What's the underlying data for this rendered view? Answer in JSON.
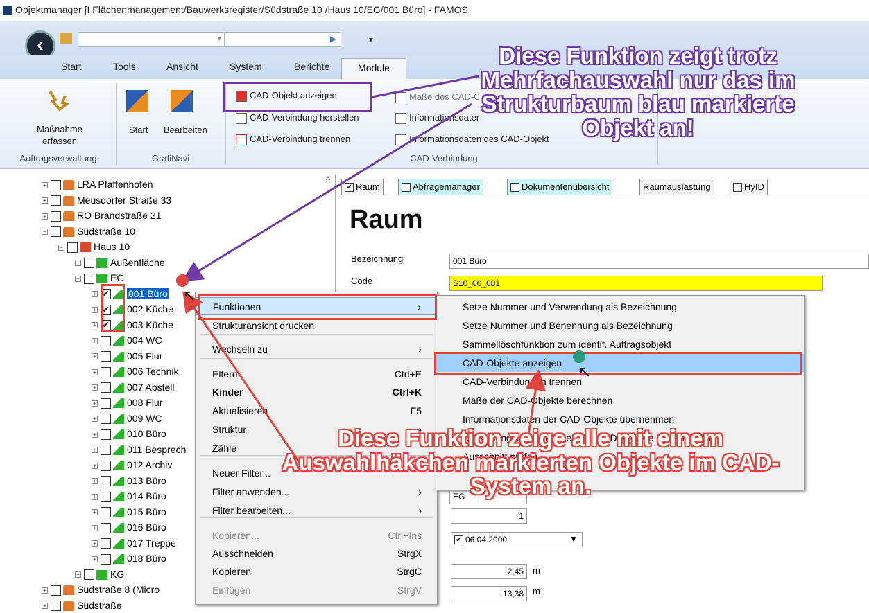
{
  "window": {
    "title": "Objektmanager [I  Flächenmanagement/Bauwerksregister/Südstraße 10  /Haus 10/EG/001 Büro] - FAMOS"
  },
  "qat": {
    "combo2_value": "▶"
  },
  "ribbon_tabs": [
    "Start",
    "Tools",
    "Ansicht",
    "System",
    "Berichte",
    "Module"
  ],
  "ribbon": {
    "auftrag": {
      "btn": "Maßnahme erfassen",
      "group": "Auftragsverwaltung"
    },
    "grafinavi": {
      "start": "Start",
      "bearbeiten": "Bearbeiten",
      "group": "GrafiNavi"
    },
    "cad": {
      "anzeigen": "CAD-Objekt anzeigen",
      "herstellen": "CAD-Verbindung herstellen",
      "trennen": "CAD-Verbindung trennen",
      "masse": "Maße des CAD-Objektes berechnen",
      "info": "Informationsdaten",
      "info2": "Informationsdaten des CAD-Objekt",
      "group": "CAD-Verbindung"
    }
  },
  "tree": [
    {
      "label": "LRA Pfaffenhofen",
      "pm": "+"
    },
    {
      "label": "Meusdorfer Straße 33",
      "pm": "+"
    },
    {
      "label": "RO Brandstraße 21",
      "pm": "+"
    },
    {
      "label": "Südstraße 10",
      "pm": "−"
    },
    {
      "label": "Haus 10",
      "pm": "−"
    },
    {
      "label": "Außenfläche",
      "pm": "+"
    },
    {
      "label": "EG",
      "pm": "−"
    },
    {
      "label": "001 Büro",
      "pm": "+",
      "checked": true,
      "selected": true
    },
    {
      "label": "002 Küche",
      "pm": "+",
      "checked": true
    },
    {
      "label": "003 Küche",
      "pm": "+",
      "checked": true
    },
    {
      "label": "004 WC",
      "pm": "+"
    },
    {
      "label": "005 Flur",
      "pm": "+"
    },
    {
      "label": "006 Technik",
      "pm": "+"
    },
    {
      "label": "007 Abstell",
      "pm": "+"
    },
    {
      "label": "008 Flur",
      "pm": "+"
    },
    {
      "label": "009 WC",
      "pm": "+"
    },
    {
      "label": "010 Büro",
      "pm": "+"
    },
    {
      "label": "011 Besprech",
      "pm": "+"
    },
    {
      "label": "012 Archiv",
      "pm": "+"
    },
    {
      "label": "013 Büro",
      "pm": "+"
    },
    {
      "label": "014 Büro",
      "pm": "+"
    },
    {
      "label": "015 Büro",
      "pm": "+"
    },
    {
      "label": "016 Büro",
      "pm": "+"
    },
    {
      "label": "017 Treppe",
      "pm": "+"
    },
    {
      "label": "018 Büro",
      "pm": "+"
    },
    {
      "label": "KG",
      "pm": "+"
    },
    {
      "label": "Südstraße 8 (Micro",
      "pm": "+"
    },
    {
      "label": "Südstraße",
      "pm": "+"
    }
  ],
  "right_tabs": [
    "Raum",
    "Abfragemanager",
    "Dokumentenübersicht",
    "Raumauslastung",
    "HyID"
  ],
  "form": {
    "title": "Raum",
    "bez_label": "Bezeichnung",
    "bez_value": "001 Büro",
    "code_label": "Code",
    "code_value": "S10_00_001",
    "eg_value": "EG",
    "num_value": "1",
    "date_value": "06.04.2000",
    "height": "2,45",
    "height_unit": "m",
    "area": "13,38",
    "area_unit": "m"
  },
  "context_menu": [
    {
      "label": "Funktionen",
      "arrow": "›"
    },
    {
      "label": "Strukturansicht drucken"
    },
    {
      "label": "Wechseln zu",
      "arrow": "›"
    },
    {
      "label": "Eltern",
      "shortcut": "Ctrl+E"
    },
    {
      "label": "Kinder",
      "shortcut": "Ctrl+K"
    },
    {
      "label": "Aktualisieren",
      "shortcut": "F5"
    },
    {
      "label": "Struktur",
      "arrow": "›"
    },
    {
      "label": "Zähle"
    },
    {
      "label": "Neuer Filter..."
    },
    {
      "label": "Filter anwenden...",
      "arrow": "›"
    },
    {
      "label": "Filter bearbeiten...",
      "arrow": "›"
    },
    {
      "label": "Kopieren...",
      "shortcut": "Ctrl+Ins"
    },
    {
      "label": "Ausschneiden",
      "shortcut": "StrgX"
    },
    {
      "label": "Kopieren",
      "shortcut": "StrgC"
    },
    {
      "label": "Einfügen",
      "shortcut": "StrgV"
    }
  ],
  "submenu": [
    "Setze Nummer und Verwendung als Bezeichnung",
    "Setze Nummer und Benennung als Bezeichnung",
    "Sammellöschfunktion zum identif. Auftragsobjekt",
    "CAD-Objekte anzeigen",
    "CAD-Verbindungen trennen",
    "Maße der CAD-Objekte berechnen",
    "Informationsdaten der CAD-Objekte übernehmen",
    "Darstellungseigenschaften der CAD-Objekte aktualisieren",
    "Ausschnitt prüfen"
  ],
  "annotations": {
    "purple": [
      "Diese Funktion zeigt trotz",
      "Mehrfachauswahl  nur das im",
      "Strukturbaum blau markierte",
      "Objekt an!"
    ],
    "red": [
      "Diese Funktion zeige alle mit einem",
      "Auswahlhäkchen markierten Objekte im CAD-",
      "System an."
    ]
  },
  "colors": {
    "annotation_purple": "#6f3aa5",
    "annotation_red": "#e0443e",
    "selection": "#0a64c8",
    "code_field": "#ffff00"
  }
}
